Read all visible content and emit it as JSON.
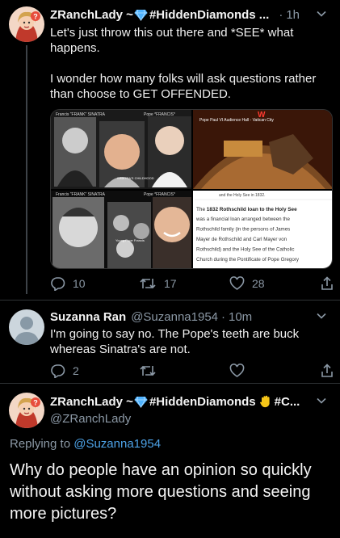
{
  "tweet1": {
    "display_name": "ZRanchLady ~ ",
    "display_name_rest": "#HiddenDiamonds ...",
    "time": "1h",
    "text_line1": "Let's just throw this out there and *SEE* what happens.",
    "text_line2": "I wonder how many folks will ask questions rather than choose to GET OFFENDED.",
    "media": {
      "top_left_caption1": "Francis \"FRANK\" SINATRA",
      "top_left_caption2": "Pope *FRANCIS*",
      "top_left_overlay": "SINATRA'S CHILDHOOD",
      "bottom_left_caption1": "Francis \"FRANK\" SINATRA",
      "bottom_left_caption2": "Pope *FRANCIS*",
      "bottom_left_overlay": "Young Pope Francis",
      "top_right_caption": "Pope Paul VI Audience Hall - Vatican City",
      "top_right_w": "W",
      "doc_top_line": "and the Holy See in 1832.",
      "doc_heading_pre": "The ",
      "doc_heading": "1832 Rothschild loan to the Holy See",
      "doc_lines": [
        "was a financial loan arranged between the",
        "Rothschild family (in the persons of James",
        "Mayer de Rothschild and Carl Mayer von",
        "Rothschild) and the Holy See of the Catholic",
        "Church during the Pontificate of Pope Gregory"
      ]
    },
    "replies": "10",
    "retweets": "17",
    "likes": "28"
  },
  "tweet2": {
    "display_name": "Suzanna Ran",
    "handle": "@Suzanna1954",
    "time": "10m",
    "text": "I'm going to say no. The Pope's teeth are buck whereas Sinatra's are not.",
    "replies": "2"
  },
  "tweet3": {
    "display_name": "ZRanchLady ~ ",
    "display_name_rest": "#HiddenDiamonds",
    "display_name_tail": "#C...",
    "handle": "@ZRanchLady",
    "replying_prefix": "Replying to ",
    "replying_handle": "@Suzanna1954",
    "text": "Why do people have an opinion so quickly without asking more questions and seeing more pictures?"
  },
  "colors": {
    "background": "#000000",
    "link": "#4da3e8",
    "secondary_text": "#8b98a5",
    "diamond": "#4fb3ff"
  }
}
